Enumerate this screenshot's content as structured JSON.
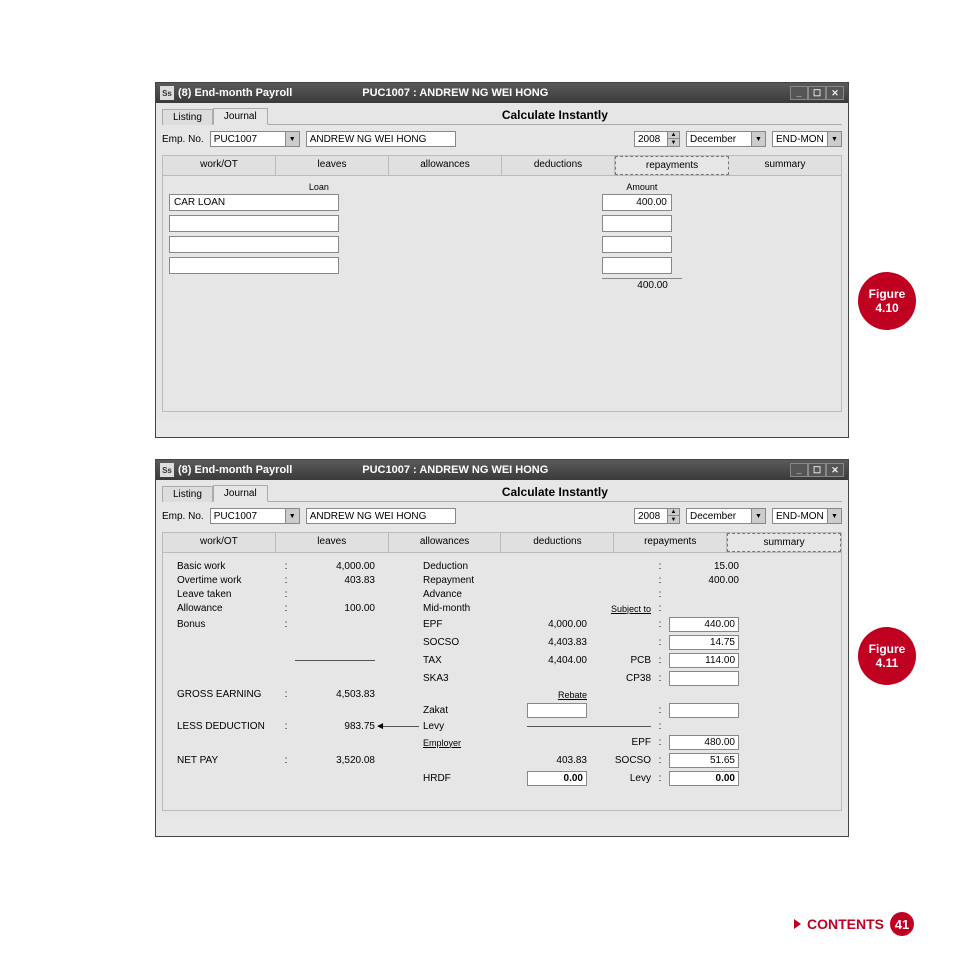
{
  "window1": {
    "title_prefix": "(8)  End-month Payroll",
    "title_emp": "PUC1007 : ANDREW NG WEI HONG",
    "tabs": {
      "listing": "Listing",
      "journal": "Journal",
      "spacer": "Calculate Instantly"
    },
    "filter": {
      "emp_no_lbl": "Emp. No.",
      "emp_no": "PUC1007",
      "emp_name": "ANDREW NG WEI HONG",
      "year": "2008",
      "month": "December",
      "period": "END-MON"
    },
    "subtabs": {
      "workot": "work/OT",
      "leaves": "leaves",
      "allowances": "allowances",
      "deductions": "deductions",
      "repayments": "repayments",
      "summary": "summary"
    },
    "repayments": {
      "loan_header": "Loan",
      "amount_header": "Amount",
      "rows": [
        {
          "loan": "CAR LOAN",
          "amount": "400.00"
        },
        {
          "loan": "",
          "amount": ""
        },
        {
          "loan": "",
          "amount": ""
        },
        {
          "loan": "",
          "amount": ""
        }
      ],
      "total": "400.00"
    }
  },
  "window2": {
    "title_prefix": "(8)  End-month Payroll",
    "title_emp": "PUC1007 : ANDREW NG WEI HONG",
    "tabs": {
      "listing": "Listing",
      "journal": "Journal",
      "spacer": "Calculate Instantly"
    },
    "filter": {
      "emp_no_lbl": "Emp. No.",
      "emp_no": "PUC1007",
      "emp_name": "ANDREW NG WEI HONG",
      "year": "2008",
      "month": "December",
      "period": "END-MON"
    },
    "subtabs": {
      "workot": "work/OT",
      "leaves": "leaves",
      "allowances": "allowances",
      "deductions": "deductions",
      "repayments": "repayments",
      "summary": "summary"
    },
    "summary": {
      "left": {
        "basic": {
          "lbl": "Basic work",
          "val": "4,000.00"
        },
        "ot": {
          "lbl": "Overtime work",
          "val": "403.83"
        },
        "leave": {
          "lbl": "Leave taken",
          "val": ""
        },
        "allow": {
          "lbl": "Allowance",
          "val": "100.00"
        },
        "bonus": {
          "lbl": "Bonus",
          "val": ""
        },
        "gross": {
          "lbl": "GROSS EARNING",
          "val": "4,503.83"
        },
        "less": {
          "lbl": "LESS DEDUCTION",
          "val": "983.75"
        },
        "net": {
          "lbl": "NET PAY",
          "val": "3,520.08"
        }
      },
      "right": {
        "deduction": {
          "lbl": "Deduction",
          "val": "15.00"
        },
        "repayment": {
          "lbl": "Repayment",
          "val": "400.00"
        },
        "advance": {
          "lbl": "Advance",
          "val": ""
        },
        "midmonth": {
          "lbl": "Mid-month",
          "val": ""
        },
        "subject": "Subject to",
        "epf": {
          "lbl": "EPF",
          "sub": "4,000.00",
          "val": "440.00"
        },
        "socso": {
          "lbl": "SOCSO",
          "sub": "4,403.83",
          "val": "14.75"
        },
        "tax": {
          "lbl": "TAX",
          "sub": "4,404.00",
          "pcb": "PCB",
          "val": "114.00"
        },
        "ska3": {
          "lbl": "SKA3",
          "cp38": "CP38",
          "val": ""
        },
        "rebate": "Rebate",
        "zakat": {
          "lbl": "Zakat",
          "val": ""
        },
        "levy": {
          "lbl": "Levy",
          "val": ""
        },
        "employer": "Employer",
        "eepf": {
          "lbl": "EPF",
          "val": "480.00"
        },
        "esocso": {
          "aux": "403.83",
          "lbl": "SOCSO",
          "val": "51.65"
        },
        "hrdf": {
          "lhs": "HRDF",
          "lval": "0.00",
          "lbl": "Levy",
          "val": "0.00"
        }
      }
    }
  },
  "figures": {
    "f1": "Figure",
    "n1": "4.10",
    "f2": "Figure",
    "n2": "4.11"
  },
  "footer": {
    "contents": "CONTENTS",
    "page": "41"
  }
}
